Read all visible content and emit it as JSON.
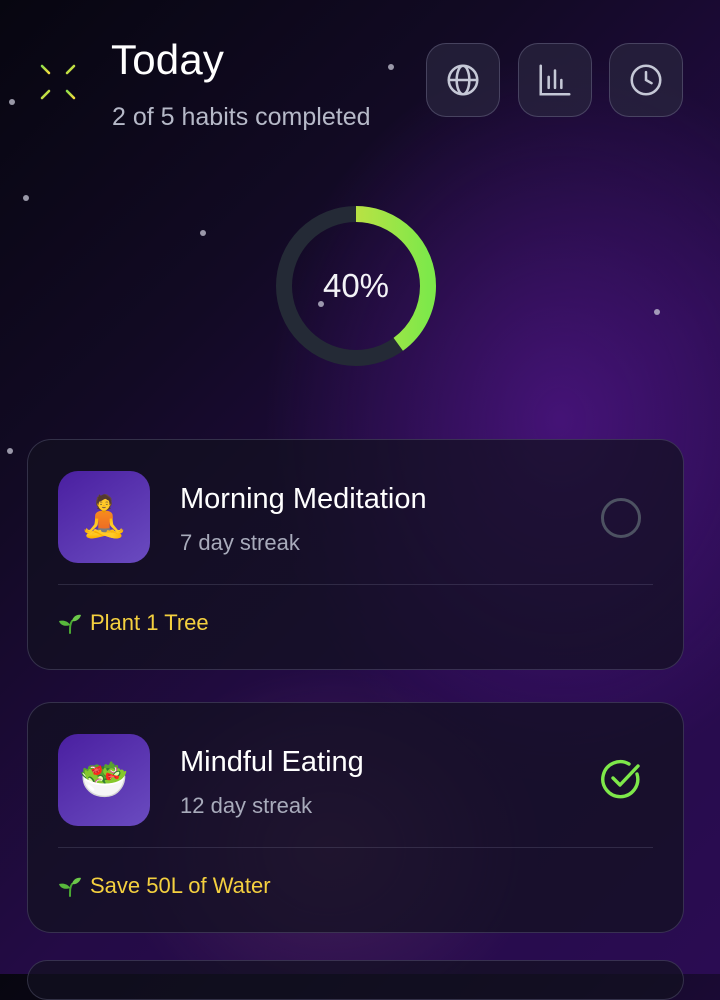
{
  "header": {
    "title": "Today",
    "subtitle": "2 of 5 habits completed",
    "app_icon": "sparkle-burst-icon",
    "buttons": [
      {
        "icon": "globe-icon"
      },
      {
        "icon": "bar-chart-icon"
      },
      {
        "icon": "clock-icon"
      }
    ]
  },
  "progress": {
    "completed": 2,
    "total": 5,
    "fraction": 0.4,
    "label": "40%",
    "colors": {
      "track": "#242a36",
      "start": "#f4dc3e",
      "end": "#7ee84a"
    }
  },
  "habits": [
    {
      "name": "Morning Meditation",
      "streak": "7 day streak",
      "icon": "meditation-icon",
      "emoji": "🧘",
      "completed": false,
      "impact_icon": "seedling-icon",
      "impact": "Plant 1 Tree"
    },
    {
      "name": "Mindful Eating",
      "streak": "12 day streak",
      "icon": "salad-bowl-icon",
      "emoji": "🥗",
      "completed": true,
      "impact_icon": "seedling-icon",
      "impact": "Save 50L of Water"
    }
  ],
  "colors": {
    "accent_yellow": "#f4d03f",
    "accent_green": "#7ee84a",
    "card_icon_gradient": [
      "#4a1fa0",
      "#6a4bc0"
    ]
  }
}
